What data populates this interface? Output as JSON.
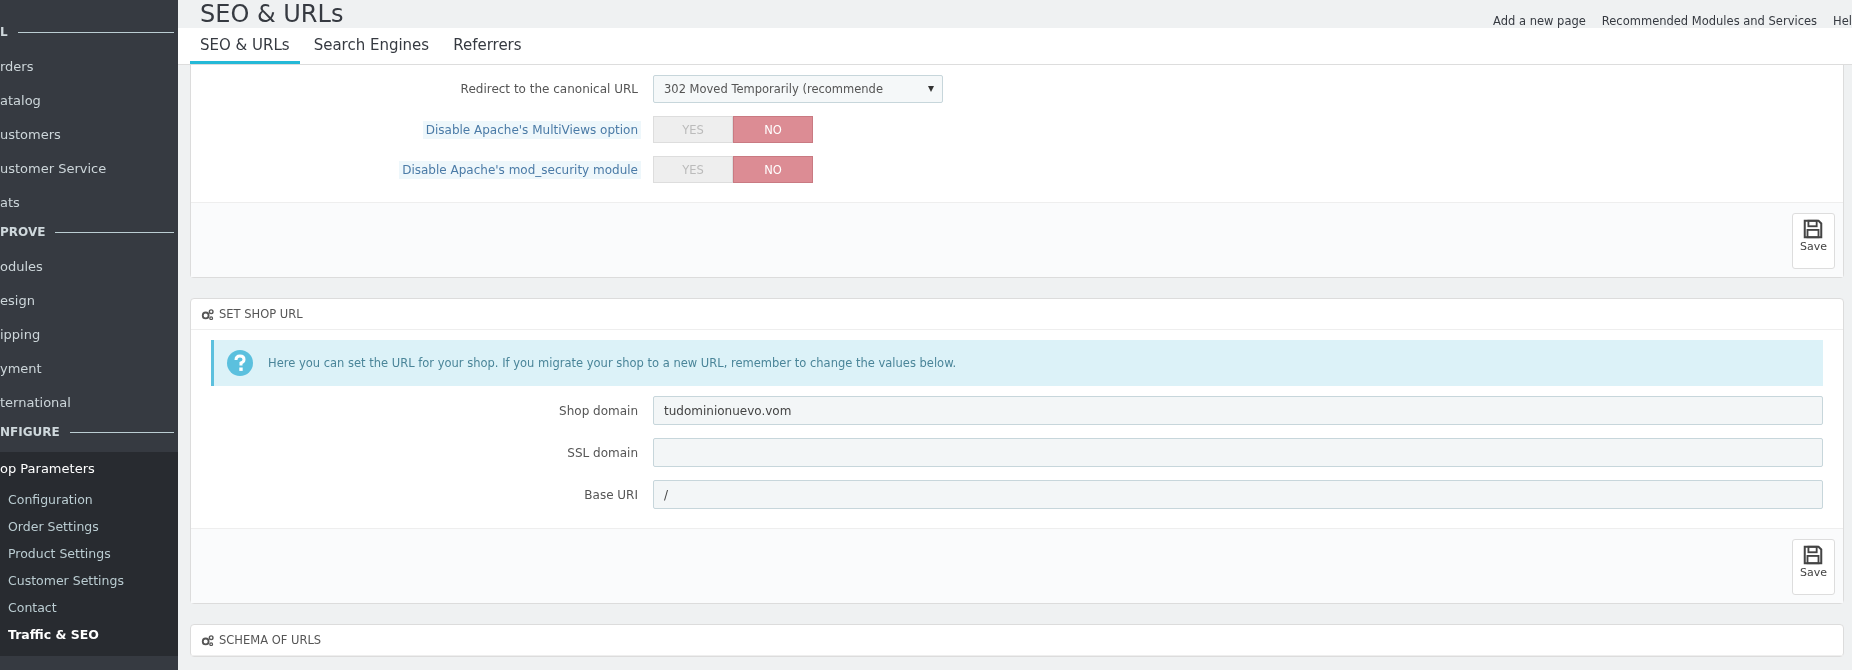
{
  "sidebar": {
    "sections": [
      {
        "heading": "L",
        "items": [
          {
            "label": "rders",
            "selected": false
          },
          {
            "label": "atalog",
            "selected": false
          },
          {
            "label": "ustomers",
            "selected": false
          },
          {
            "label": "ustomer Service",
            "selected": false
          },
          {
            "label": "ats",
            "selected": false
          }
        ]
      },
      {
        "heading": "PROVE",
        "items": [
          {
            "label": "odules",
            "selected": false
          },
          {
            "label": "esign",
            "selected": false
          },
          {
            "label": "ipping",
            "selected": false
          },
          {
            "label": "yment",
            "selected": false
          },
          {
            "label": "ternational",
            "selected": false
          }
        ]
      },
      {
        "heading": "NFIGURE",
        "items": [
          {
            "label": "op Parameters",
            "selected": false,
            "expanded": true,
            "children": [
              {
                "label": "Configuration",
                "selected": false
              },
              {
                "label": "Order Settings",
                "selected": false
              },
              {
                "label": "Product Settings",
                "selected": false
              },
              {
                "label": "Customer Settings",
                "selected": false
              },
              {
                "label": "Contact",
                "selected": false
              },
              {
                "label": "Traffic & SEO",
                "selected": true
              }
            ]
          }
        ]
      }
    ]
  },
  "page": {
    "title": "SEO & URLs"
  },
  "toolbar": [
    {
      "label": "Add a new page"
    },
    {
      "label": "Recommended Modules and Services"
    },
    {
      "label": "Hel"
    }
  ],
  "tabs": [
    {
      "label": "SEO & URLs",
      "selected": true
    },
    {
      "label": "Search Engines",
      "selected": false
    },
    {
      "label": "Referrers",
      "selected": false
    }
  ],
  "panels": [
    {
      "fields": [
        {
          "kind": "select",
          "label": "Redirect to the canonical URL",
          "tooltip": false,
          "value": "302 Moved Temporarily (recommende"
        },
        {
          "kind": "switch",
          "label": "Disable Apache's MultiViews option",
          "tooltip": true,
          "options": [
            {
              "label": "YES",
              "selected": false
            },
            {
              "label": "NO",
              "selected": true
            }
          ]
        },
        {
          "kind": "switch",
          "label": "Disable Apache's mod_security module",
          "tooltip": true,
          "options": [
            {
              "label": "YES",
              "selected": false
            },
            {
              "label": "NO",
              "selected": true
            }
          ]
        }
      ],
      "save": "Save"
    },
    {
      "heading": "SET SHOP URL",
      "alert": "Here you can set the URL for your shop. If you migrate your shop to a new URL, remember to change the values below.",
      "fields": [
        {
          "kind": "text",
          "label": "Shop domain",
          "tooltip": false,
          "value": "tudominionuevo.vom"
        },
        {
          "kind": "text",
          "label": "SSL domain",
          "tooltip": false
        },
        {
          "kind": "text",
          "label": "Base URI",
          "tooltip": false,
          "value": "/"
        }
      ],
      "save": "Save"
    },
    {
      "heading": "SCHEMA OF URLS"
    }
  ]
}
